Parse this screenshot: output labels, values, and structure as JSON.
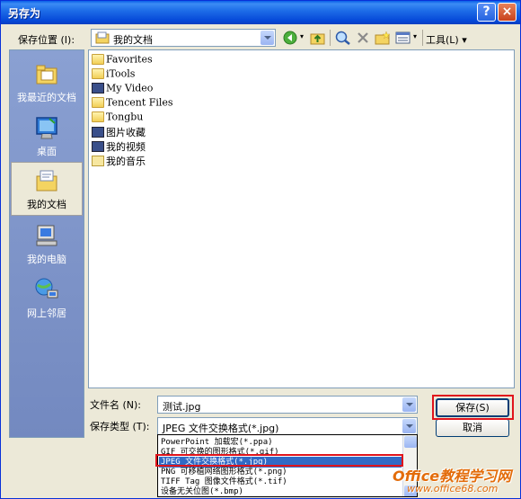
{
  "window": {
    "title": "另存为",
    "help": "?",
    "close": "×"
  },
  "toolbar": {
    "save_in_label": "保存位置 (I):",
    "location": "我的文档",
    "tools_label": "工具(L)"
  },
  "places": [
    {
      "label": "我最近的文档",
      "icon": "recent-docs-icon"
    },
    {
      "label": "桌面",
      "icon": "desktop-icon"
    },
    {
      "label": "我的文档",
      "icon": "my-documents-icon",
      "active": true
    },
    {
      "label": "我的电脑",
      "icon": "my-computer-icon"
    },
    {
      "label": "网上邻居",
      "icon": "network-icon"
    }
  ],
  "files": [
    {
      "name": "Favorites",
      "icon": "folder-icon"
    },
    {
      "name": "iTools",
      "icon": "folder-icon"
    },
    {
      "name": "My Video",
      "icon": "video-folder-icon"
    },
    {
      "name": "Tencent Files",
      "icon": "folder-icon"
    },
    {
      "name": "Tongbu",
      "icon": "folder-icon"
    },
    {
      "name": "图片收藏",
      "icon": "pictures-folder-icon"
    },
    {
      "name": "我的视频",
      "icon": "video-folder-icon"
    },
    {
      "name": "我的音乐",
      "icon": "music-folder-icon"
    }
  ],
  "form": {
    "filename_label": "文件名 (N):",
    "filename_value": "测试.jpg",
    "filetype_label": "保存类型 (T):",
    "filetype_value": "JPEG 文件交换格式(*.jpg)",
    "save_button": "保存(S)",
    "cancel_button": "取消"
  },
  "filetype_options": [
    "PowerPoint 加载宏(*.ppa)",
    "GIF 可交换的图形格式(*.gif)",
    "JPEG 文件交换格式(*.jpg)",
    "PNG 可移植网络图形格式(*.png)",
    "TIFF Tag 图像文件格式(*.tif)",
    "设备无关位图(*.bmp)"
  ],
  "selected_option_index": 2,
  "watermark": {
    "brand": "Office教程学习网",
    "url": "www.office68.com"
  },
  "colors": {
    "title_bar": "#0548d8",
    "selection": "#316ac5",
    "highlight_box": "#e0141c",
    "watermark": "#e36c0a"
  }
}
